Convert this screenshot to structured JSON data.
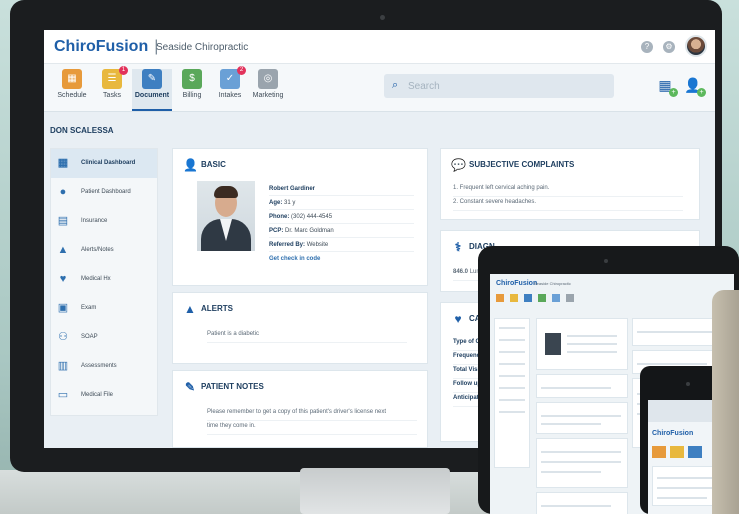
{
  "app": {
    "logo": "ChiroFusion",
    "practice": "Seaside Chiropractic"
  },
  "toolbar": {
    "items": [
      {
        "label": "Schedule",
        "color": "#e79a3b",
        "badge": ""
      },
      {
        "label": "Tasks",
        "color": "#e8b83e",
        "badge": "1"
      },
      {
        "label": "Document",
        "color": "#3e7fc1",
        "badge": ""
      },
      {
        "label": "Billing",
        "color": "#5aa85a",
        "badge": ""
      },
      {
        "label": "Intakes",
        "color": "#6aa0d6",
        "badge": "2"
      },
      {
        "label": "Marketing",
        "color": "#9aa4ad",
        "badge": ""
      }
    ],
    "search_placeholder": "Search"
  },
  "patient_name": "DON SCALESSA",
  "sidebar": {
    "items": [
      {
        "label": "Clinical Dashboard",
        "icon": "dashboard-icon"
      },
      {
        "label": "Patient Dashboard",
        "icon": "person-icon"
      },
      {
        "label": "Insurance",
        "icon": "document-icon"
      },
      {
        "label": "Alerts/Notes",
        "icon": "warning-icon"
      },
      {
        "label": "Medical Hx",
        "icon": "heart-icon"
      },
      {
        "label": "Exam",
        "icon": "exam-icon"
      },
      {
        "label": "SOAP",
        "icon": "people-icon"
      },
      {
        "label": "Assessments",
        "icon": "clipboard-icon"
      },
      {
        "label": "Medical File",
        "icon": "file-icon"
      }
    ]
  },
  "basic": {
    "title": "BASIC",
    "name": "Robert Gardiner",
    "age_label": "Age:",
    "age": "31 y",
    "phone_label": "Phone:",
    "phone": "(302) 444-4545",
    "pcp_label": "PCP:",
    "pcp": "Dr. Marc Goldman",
    "referred_label": "Referred By:",
    "referred": "Website",
    "link": "Get check in code"
  },
  "alerts": {
    "title": "ALERTS",
    "items": [
      "Patient is a diabetic"
    ]
  },
  "notes": {
    "title": "PATIENT NOTES",
    "lines": [
      "Please remember to get a copy of this patient's driver's license next",
      "time they come in."
    ]
  },
  "complaints": {
    "title": "SUBJECTIVE COMPLAINTS",
    "items": [
      "1.  Frequent left cervical aching pain.",
      "2.  Constant severe headaches."
    ]
  },
  "diagnosis": {
    "title": "DIAGN",
    "code": "846.0",
    "text": "Lum"
  },
  "care": {
    "title": "CARE",
    "rows": [
      "Type of Ca",
      "Frequency",
      "Total Visit",
      "Follow up",
      "Anticipate"
    ]
  },
  "tablet": {
    "logo": "ChiroFusion",
    "practice": "Seaside Chiropractic"
  },
  "phone": {
    "logo": "ChiroFusion"
  }
}
